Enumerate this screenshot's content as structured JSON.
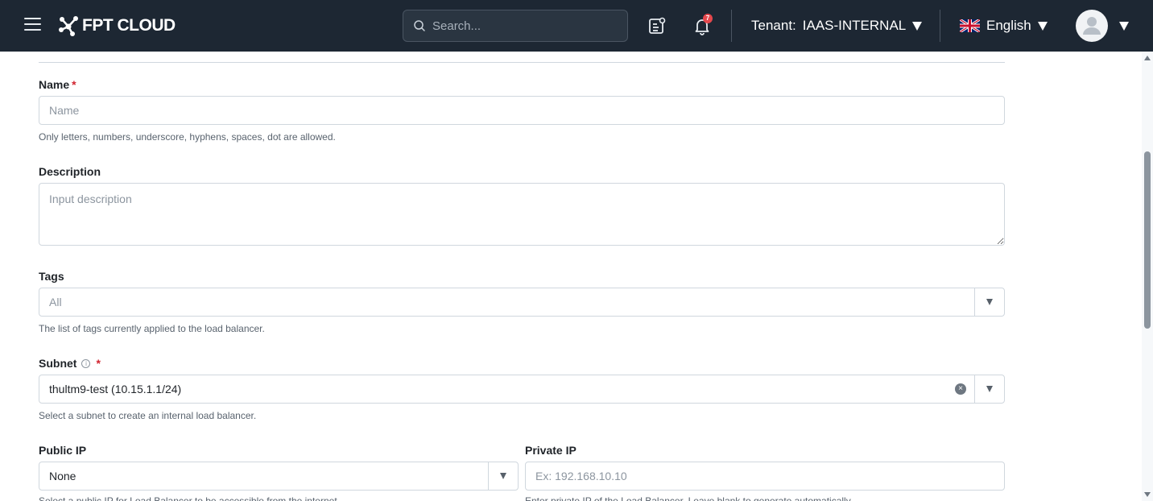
{
  "header": {
    "brand": "FPT CLOUD",
    "search_placeholder": "Search...",
    "notification_count": "7",
    "tenant_label": "Tenant:",
    "tenant_value": "IAAS-INTERNAL",
    "language": "English",
    "icons": {
      "menu": "hamburger-icon",
      "search": "search-icon",
      "tasks": "clipboard-icon",
      "notifications": "bell-icon",
      "language_flag": "uk-flag-icon",
      "avatar": "user-avatar-icon"
    },
    "colors": {
      "background": "#1d2733",
      "badge": "#e5484d"
    }
  },
  "form": {
    "name": {
      "label": "Name",
      "required_mark": "*",
      "placeholder": "Name",
      "help": "Only letters, numbers, underscore, hyphens, spaces, dot are allowed."
    },
    "description": {
      "label": "Description",
      "placeholder": "Input description"
    },
    "tags": {
      "label": "Tags",
      "value": "All",
      "help": "The list of tags currently applied to the load balancer."
    },
    "subnet": {
      "label": "Subnet",
      "required_mark": "*",
      "value": "thultm9-test (10.15.1.1/24)",
      "help": "Select a subnet to create an internal load balancer."
    },
    "public_ip": {
      "label": "Public IP",
      "value": "None",
      "help": "Select a public IP for Load Balancer to be accessible from the internet."
    },
    "private_ip": {
      "label": "Private IP",
      "placeholder": "Ex: 192.168.10.10",
      "help": "Enter private IP of the Load Balancer. Leave blank to generate automatically."
    }
  }
}
